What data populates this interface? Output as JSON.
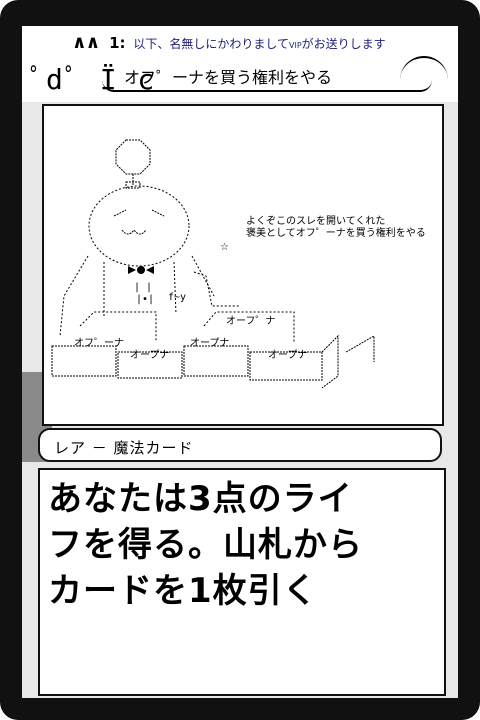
{
  "header": {
    "arrows": "∧∧",
    "post_number": "1:",
    "poster_text": "以下、名無しにかわりまして",
    "vip_tag": "VIP",
    "poster_text_end": "がお送りします"
  },
  "card": {
    "title": "オフ゜ーナを買う権利をやる",
    "art": {
      "speech_line1": "よくぞこのスレを開いてくれた",
      "speech_line2": "褒美としてオフ゜ーナを買う権利をやる",
      "box_labels": [
        "オーフ゜ナ",
        "オフ゜ーナ",
        "オープナ",
        "オープナ",
        "オープナ"
      ],
      "star": "☆"
    },
    "type_line": "レア － 魔法カード",
    "rules_text_lines": [
      "あなたは3点のライ",
      "フを得る。山札から",
      "カードを1枚引く"
    ]
  }
}
